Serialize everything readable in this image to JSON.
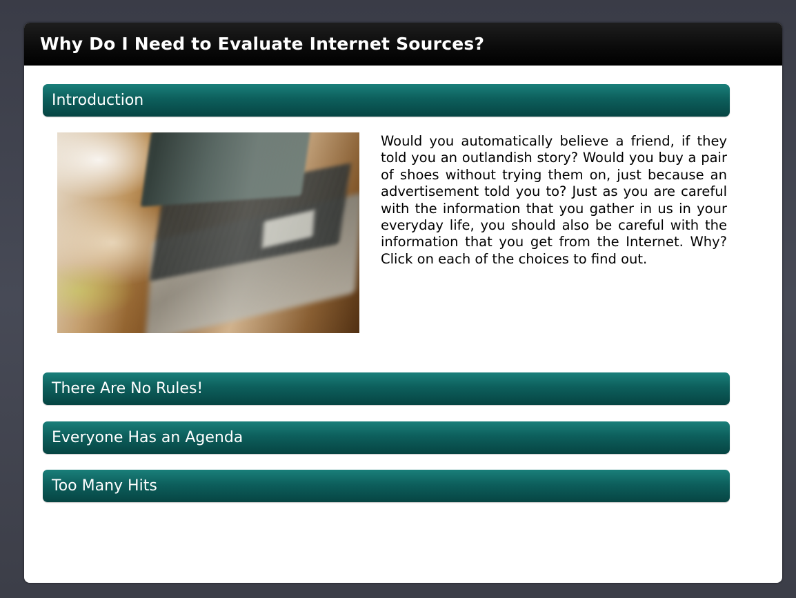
{
  "page": {
    "title": "Why Do I Need to Evaluate Internet Sources?"
  },
  "accordion": {
    "items": [
      {
        "label": "Introduction"
      },
      {
        "label": "There Are No Rules!"
      },
      {
        "label": "Everyone Has an Agenda"
      },
      {
        "label": "Too Many Hits"
      }
    ]
  },
  "intro": {
    "image": "laptop-motion-blur-photo",
    "body": "Would you automatically believe a friend, if they told you an outlandish story? Would you buy a pair of shoes without trying them on, just because an advertisement told you to? Just as you are careful with the information that you gather in us in your everyday life, you should also be careful with the information that you get from the Internet. Why? Click on each of the choices to find out."
  },
  "colors": {
    "header_teal": "#0d5f5c",
    "title_bar": "#000000",
    "background": "#40424d"
  }
}
